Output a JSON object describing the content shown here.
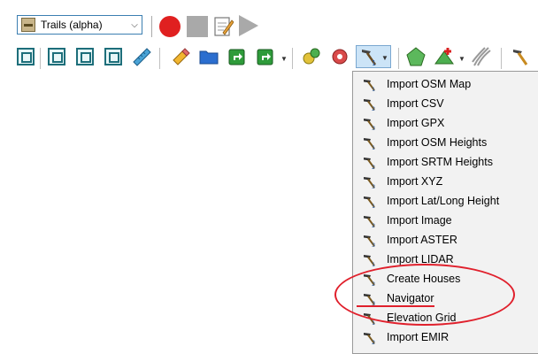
{
  "toolbar": {
    "scene_combo": {
      "value": "Trails (alpha)"
    }
  },
  "import_menu": {
    "items": [
      {
        "label": "Import OSM Map"
      },
      {
        "label": "Import CSV"
      },
      {
        "label": "Import GPX"
      },
      {
        "label": "Import OSM Heights"
      },
      {
        "label": "Import SRTM Heights"
      },
      {
        "label": "Import XYZ"
      },
      {
        "label": "Import Lat/Long Height"
      },
      {
        "label": "Import Image"
      },
      {
        "label": "Import ASTER"
      },
      {
        "label": "Import LIDAR"
      },
      {
        "label": "Create Houses"
      },
      {
        "label": "Navigator"
      },
      {
        "label": "Elevation Grid"
      },
      {
        "label": "Import EMIR"
      }
    ]
  },
  "colors": {
    "annotation": "#e0202c",
    "record": "#e02020",
    "accent": "#1d6e7a"
  }
}
